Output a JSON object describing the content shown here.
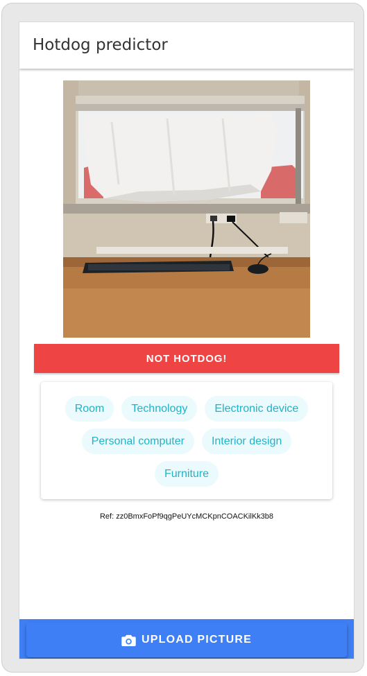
{
  "appbar": {
    "title": "Hotdog predictor"
  },
  "photo": {
    "subject": "office desk with keyboard and mouse below a window"
  },
  "result": {
    "verdict": "NOT HOTDOG!",
    "verdict_color": "#ef4444"
  },
  "labels": [
    "Room",
    "Technology",
    "Electronic device",
    "Personal computer",
    "Interior design",
    "Furniture"
  ],
  "reference": "Ref: zz0BmxFoPf9qgPeUYcMCKpnCOACKilKk3b8",
  "actions": {
    "upload_label": "UPLOAD PICTURE",
    "upload_icon": "camera-icon",
    "accent_color": "#3f7ff5"
  },
  "colors": {
    "chip_bg": "#ebfafd",
    "chip_text": "#1fb3c7"
  }
}
